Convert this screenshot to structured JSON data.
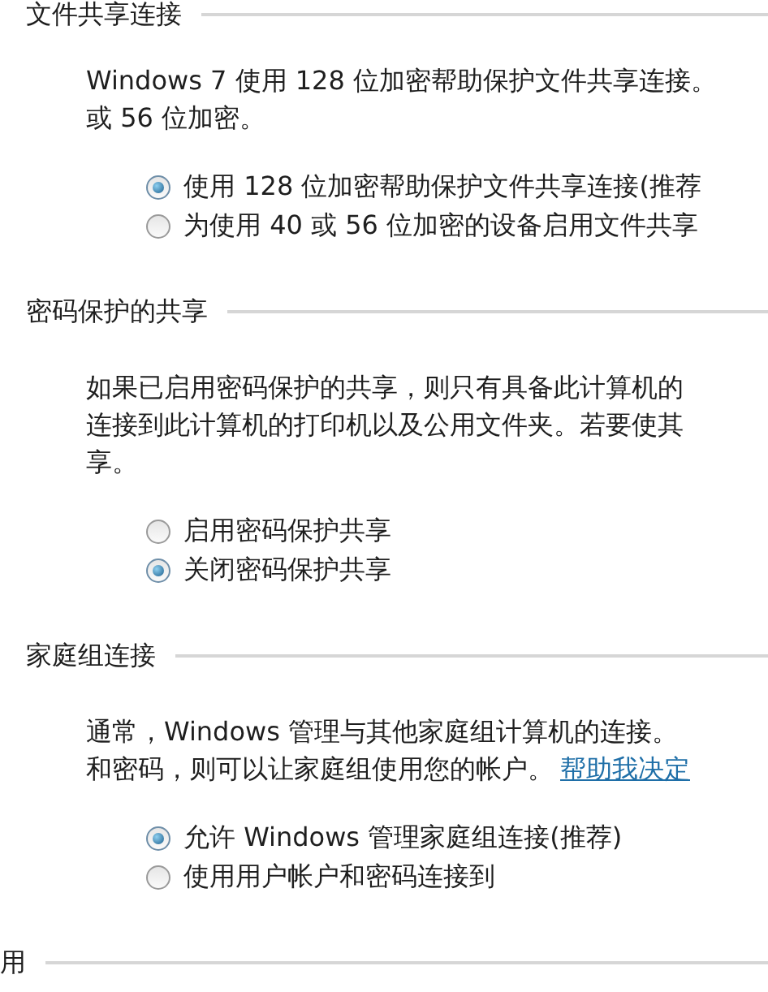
{
  "sections": [
    {
      "title": "文件共享连接",
      "lines": [
        "Windows 7 使用 128 位加密帮助保护文件共享连接。",
        "或 56 位加密。"
      ],
      "options": [
        {
          "label": "使用 128 位加密帮助保护文件共享连接(推荐",
          "selected": true
        },
        {
          "label": "为使用 40 或 56 位加密的设备启用文件共享",
          "selected": false
        }
      ]
    },
    {
      "title": "密码保护的共享",
      "lines": [
        "如果已启用密码保护的共享，则只有具备此计算机的",
        "连接到此计算机的打印机以及公用文件夹。若要使其",
        "享。"
      ],
      "options": [
        {
          "label": "启用密码保护共享",
          "selected": false
        },
        {
          "label": "关闭密码保护共享",
          "selected": true
        }
      ]
    },
    {
      "title": "家庭组连接",
      "lines": [
        "通常，Windows 管理与其他家庭组计算机的连接。",
        "和密码，则可以让家庭组使用您的帐户。"
      ],
      "link": "帮助我决定",
      "options": [
        {
          "label": "允许 Windows 管理家庭组连接(推荐)",
          "selected": true
        },
        {
          "label": "使用用户帐户和密码连接到",
          "selected": false
        }
      ]
    },
    {
      "title": "用"
    }
  ]
}
